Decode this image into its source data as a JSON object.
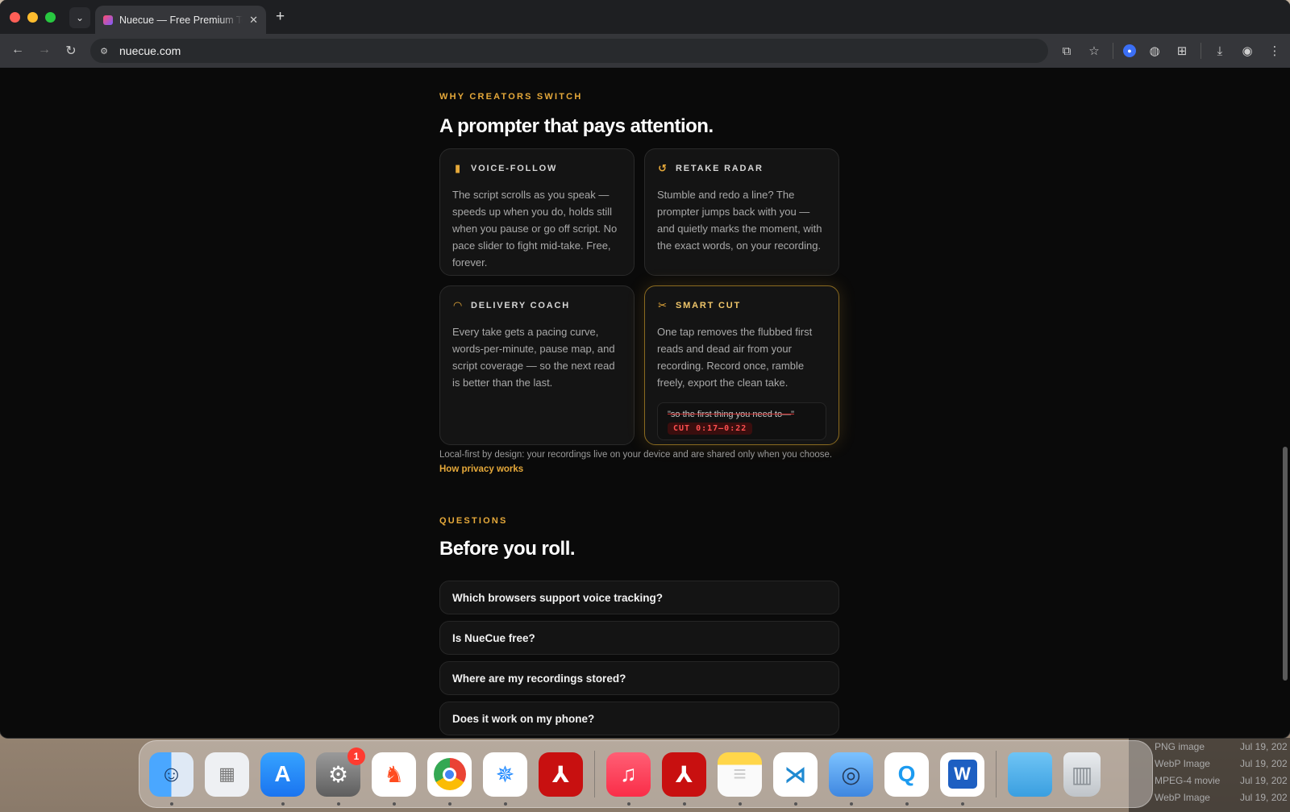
{
  "browser": {
    "tab_title": "Nuecue — Free Premium Teleprompter",
    "new_tab_label": "+",
    "url": "nuecue.com"
  },
  "features": {
    "eyebrow": "WHY CREATORS SWITCH",
    "title": "A prompter that pays attention.",
    "cards": [
      {
        "icon": "waveform-icon",
        "title": "VOICE-FOLLOW",
        "body": "The script scrolls as you speak — speeds up when you do, holds still when you pause or go off script. No pace slider to fight mid-take. Free, forever."
      },
      {
        "icon": "undo-arrow-icon",
        "title": "RETAKE RADAR",
        "body": "Stumble and redo a line? The prompter jumps back with you — and quietly marks the moment, with the exact words, on your recording."
      },
      {
        "icon": "gauge-icon",
        "title": "DELIVERY COACH",
        "body": "Every take gets a pacing curve, words-per-minute, pause map, and script coverage — so the next read is better than the last."
      },
      {
        "icon": "scissors-icon",
        "title": "SMART CUT",
        "body": "One tap removes the flubbed first reads and dead air from your recording. Record once, ramble freely, export the clean take.",
        "snippet_quote": "\"so the first thing you need to—\"",
        "cut_label": "CUT 0:17–0:22"
      }
    ],
    "privacy_text": "Local-first by design: your recordings live on your device and are shared only when you choose.",
    "privacy_link": "How privacy works"
  },
  "faq": {
    "eyebrow": "QUESTIONS",
    "title": "Before you roll.",
    "items": [
      "Which browsers support voice tracking?",
      "Is NueCue free?",
      "Where are my recordings stored?",
      "Does it work on my phone?"
    ]
  },
  "dock": {
    "settings_badge": "1"
  },
  "finder_list": [
    {
      "kind": "PNG image",
      "date": "Jul 19, 202"
    },
    {
      "kind": "WebP Image",
      "date": "Jul 19, 202"
    },
    {
      "kind": "MPEG-4 movie",
      "date": "Jul 19, 202"
    },
    {
      "kind": "WebP Image",
      "date": "Jul 19, 202"
    }
  ],
  "colors": {
    "accent": "#e6a93a",
    "page_bg": "#0a0a0a",
    "card_bg": "#141414",
    "cut_red": "#ff5050"
  }
}
